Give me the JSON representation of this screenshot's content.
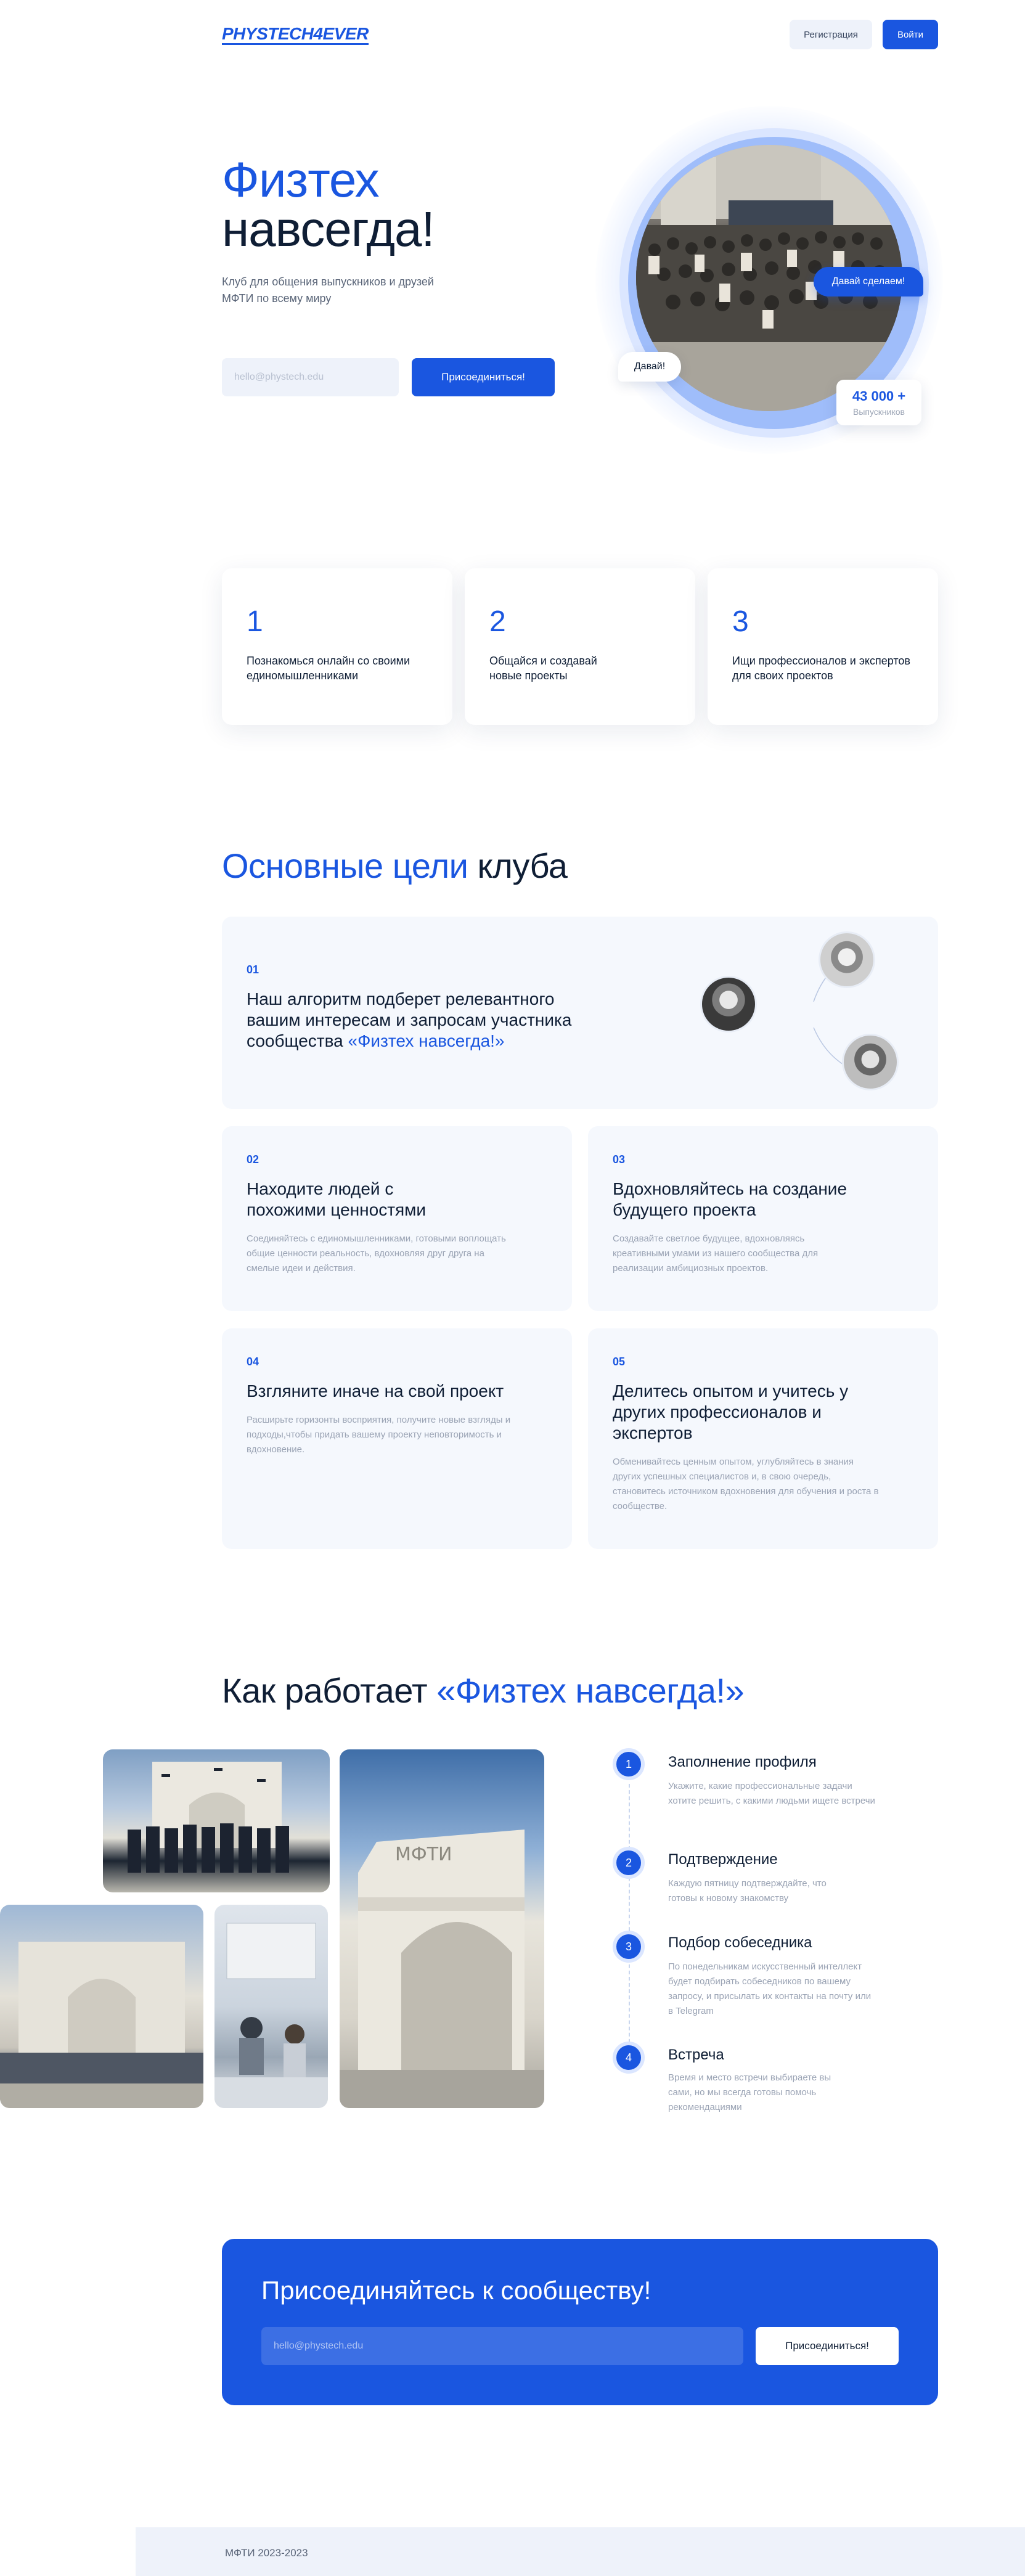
{
  "header": {
    "logo": "PHYSTECH4EVER",
    "register_label": "Регистрация",
    "login_label": "Войти"
  },
  "hero": {
    "title_line1": "Физтех",
    "title_line2": "навсегда!",
    "subtitle": "Клуб для общения выпускников и друзей МФТИ по всему миру",
    "email_placeholder": "hello@phystech.edu",
    "join_label": "Присоединиться!",
    "bubble_blue": "Давай сделаем!",
    "bubble_white": "Давай!",
    "alumni_count": "43 000 +",
    "alumni_label": "Выпускников"
  },
  "features": [
    {
      "num": "1",
      "text": "Познакомься онлайн со своими единомышленниками"
    },
    {
      "num": "2",
      "text": "Общайся и создавай новые проекты"
    },
    {
      "num": "3",
      "text": "Ищи профессионалов и экспертов для своих проектов"
    }
  ],
  "goals": {
    "title_accent": "Основные цели",
    "title_rest": " клуба",
    "items": [
      {
        "num": "01",
        "title": "Наш алгоритм подберет релевантного вашим интересам и запросам участника сообщества ",
        "title_accent": "«Физтех навсегда!»",
        "desc": ""
      },
      {
        "num": "02",
        "title": "Находите людей с похожими ценностями",
        "desc": "Соединяйтесь с единомышленниками, готовыми воплощать общие ценности реальность, вдохновляя друг друга на смелые идеи и действия."
      },
      {
        "num": "03",
        "title": "Вдохновляйтесь на создание будущего проекта",
        "desc": "Создавайте светлое будущее, вдохновляясь креативными умами из нашего сообщества для реализации амбициозных проектов."
      },
      {
        "num": "04",
        "title": "Взгляните иначе на свой проект",
        "desc": "Расширьте горизонты восприятия, получите новые взгляды и подходы,чтобы придать вашему проекту неповторимость и вдохновение."
      },
      {
        "num": "05",
        "title": "Делитесь опытом и учитесь у других профессионалов и экспертов",
        "desc": "Обменивайтесь ценным опытом, углубляйтесь в знания других успешных специалистов и, в свою очередь, становитесь источником вдохновения для обучения и роста в сообществе."
      }
    ]
  },
  "how": {
    "title_rest": "Как работает ",
    "title_accent": "«Физтех навсегда!»",
    "steps": [
      {
        "num": "1",
        "title": "Заполнение профиля",
        "desc": "Укажите, какие профессиональные задачи хотите решить, с какими людьми ищете встречи"
      },
      {
        "num": "2",
        "title": "Подтверждение",
        "desc": "Каждую пятницу подтверждайте, что готовы к новому знакомству"
      },
      {
        "num": "3",
        "title": "Подбор собеседника",
        "desc": "По понедельникам искусственный интеллект будет подбирать собеседников по вашему запросу, и присылать их контакты на почту или в Telegram"
      },
      {
        "num": "4",
        "title": "Встреча",
        "desc": "Время и место встречи выбираете вы сами, но мы всегда готовы помочь рекомендациями"
      }
    ],
    "building_sign": "МФТИ"
  },
  "cta": {
    "title": "Присоединяйтесь к сообществу!",
    "email_placeholder": "hello@phystech.edu",
    "join_label": "Присоединиться!"
  },
  "footer": {
    "copyright": "МФТИ 2023-2023"
  },
  "colors": {
    "accent": "#1a56e0",
    "text": "#0f1e35",
    "muted": "#9aa3b4",
    "card_bg": "#f5f8fd"
  }
}
